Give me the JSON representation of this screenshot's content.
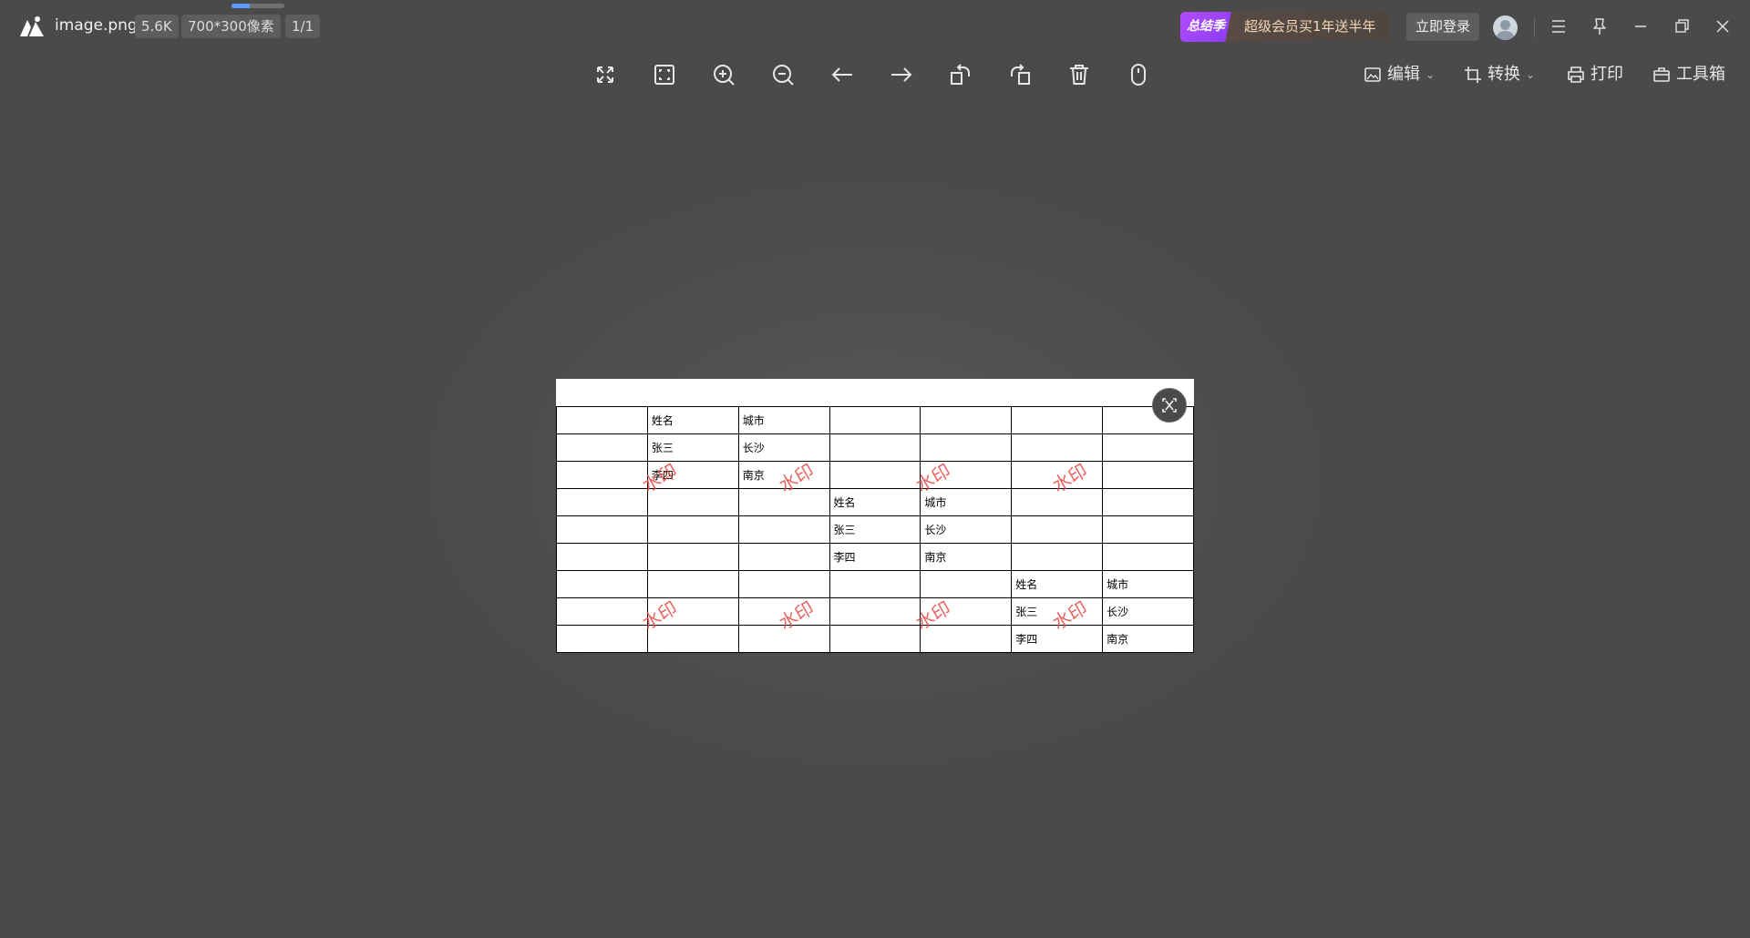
{
  "app": {
    "filename": "image.png",
    "filesize": "5.6K",
    "dimensions": "700*300像素",
    "page_count": "1/1",
    "load_progress": 0.35
  },
  "promo": {
    "badge": "总结季",
    "text": "超级会员买1年送半年"
  },
  "header": {
    "login_label": "立即登录"
  },
  "toolbar": {
    "edit_label": "编辑",
    "convert_label": "转换",
    "print_label": "打印",
    "toolbox_label": "工具箱",
    "icons": [
      "fit-window-icon",
      "actual-size-icon",
      "zoom-in-icon",
      "zoom-out-icon",
      "previous-icon",
      "next-icon",
      "rotate-left-icon",
      "rotate-right-icon",
      "delete-icon",
      "mouse-icon"
    ]
  },
  "image": {
    "rows": [
      [
        "",
        "",
        "",
        "",
        "",
        "",
        ""
      ],
      [
        "",
        "姓名",
        "城市",
        "",
        "",
        "",
        ""
      ],
      [
        "",
        "张三",
        "长沙",
        "",
        "",
        "",
        ""
      ],
      [
        "",
        "李四",
        "南京",
        "",
        "",
        "",
        ""
      ],
      [
        "",
        "",
        "",
        "姓名",
        "城市",
        "",
        ""
      ],
      [
        "",
        "",
        "",
        "张三",
        "长沙",
        "",
        ""
      ],
      [
        "",
        "",
        "",
        "李四",
        "南京",
        "",
        ""
      ],
      [
        "",
        "",
        "",
        "",
        "",
        "姓名",
        "城市"
      ],
      [
        "",
        "",
        "",
        "",
        "",
        "张三",
        "长沙"
      ],
      [
        "",
        "",
        "",
        "",
        "",
        "李四",
        "南京"
      ]
    ],
    "watermark": "水印"
  },
  "colors": {
    "background": "#4b4b4b",
    "watermark": "#e8534f",
    "promo_badge": "#9b45f5",
    "progress": "#5a9bff"
  }
}
